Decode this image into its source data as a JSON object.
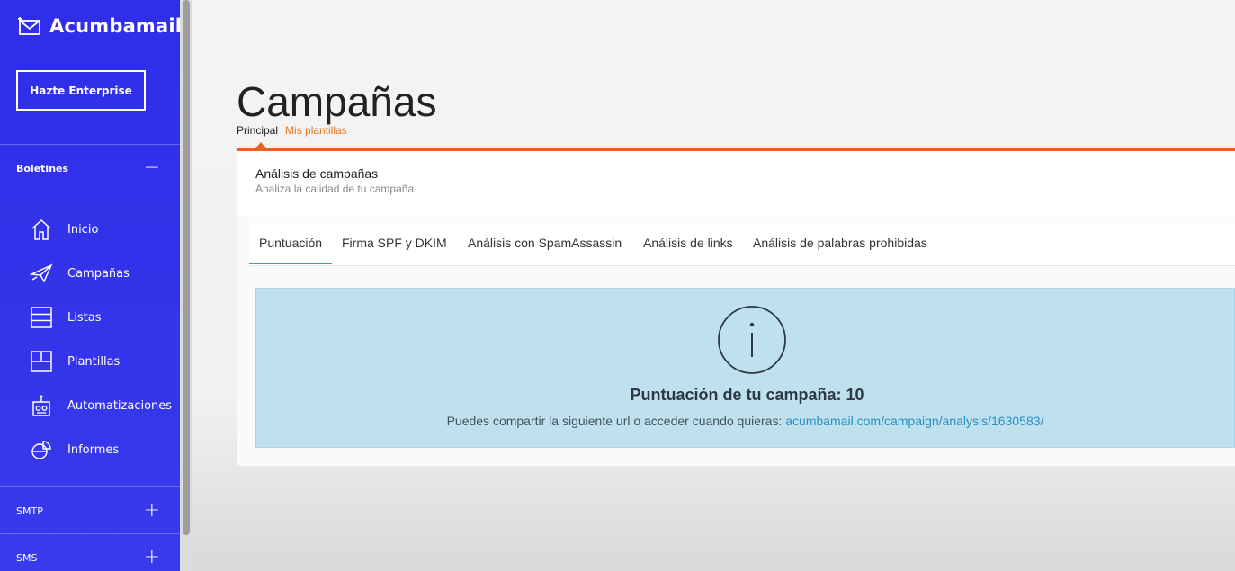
{
  "brand": {
    "name": "Acumbamail"
  },
  "sidebar": {
    "enterprise_button": "Hazte Enterprise",
    "sections": {
      "boletines": {
        "label": "Boletines",
        "toggle": "−"
      },
      "smtp": {
        "label": "SMTP",
        "toggle": "+"
      },
      "sms": {
        "label": "SMS",
        "toggle": "+"
      }
    },
    "items": [
      {
        "label": "Inicio",
        "icon": "home-icon"
      },
      {
        "label": "Campañas",
        "icon": "paper-plane-icon"
      },
      {
        "label": "Listas",
        "icon": "list-icon"
      },
      {
        "label": "Plantillas",
        "icon": "template-icon"
      },
      {
        "label": "Automatizaciones",
        "icon": "robot-icon"
      },
      {
        "label": "Informes",
        "icon": "report-icon"
      }
    ]
  },
  "page": {
    "title": "Campañas",
    "subnav": {
      "active": "Principal",
      "link": "Mis plantillas"
    }
  },
  "card": {
    "title": "Análisis de campañas",
    "subtitle": "Analiza la calidad de tu campaña",
    "tabs": [
      "Puntuación",
      "Firma SPF y DKIM",
      "Análisis con SpamAssassin",
      "Análisis de links",
      "Análisis de palabras prohibidas"
    ]
  },
  "alert": {
    "icon": "info-icon",
    "title": "Puntuación de tu campaña: 10",
    "text": "Puedes compartir la siguiente url o acceder cuando quieras:",
    "link": "acumbamail.com/campaign/analysis/1630583/"
  },
  "colors": {
    "sidebar": "#3232ea",
    "accent_orange": "#e8621c",
    "alert_bg": "#bfe1ee",
    "link": "#2a8fc1",
    "tab_underline": "#4a90d9"
  }
}
